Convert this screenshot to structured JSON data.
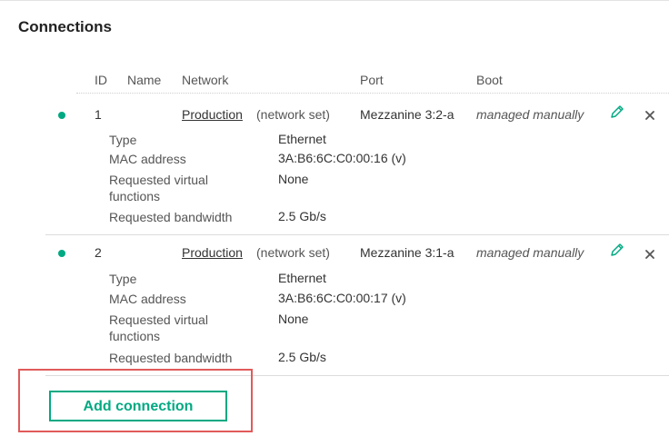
{
  "section": {
    "title": "Connections"
  },
  "table": {
    "headers": {
      "id": "ID",
      "name": "Name",
      "network": "Network",
      "port": "Port",
      "boot": "Boot"
    }
  },
  "connections": [
    {
      "id": "1",
      "network_name": "Production",
      "network_type": "(network set)",
      "port": "Mezzanine 3:2-a",
      "boot": "managed manually",
      "details": [
        {
          "label": "Type",
          "value": "Ethernet"
        },
        {
          "label": "MAC address",
          "value": "3A:B6:6C:C0:00:16 (v)"
        },
        {
          "label": "Requested virtual functions",
          "value": "None"
        },
        {
          "label": "Requested bandwidth",
          "value": "2.5 Gb/s"
        }
      ]
    },
    {
      "id": "2",
      "network_name": "Production",
      "network_type": "(network set)",
      "port": "Mezzanine 3:1-a",
      "boot": "managed manually",
      "details": [
        {
          "label": "Type",
          "value": "Ethernet"
        },
        {
          "label": "MAC address",
          "value": "3A:B6:6C:C0:00:17 (v)"
        },
        {
          "label": "Requested virtual functions",
          "value": "None"
        },
        {
          "label": "Requested bandwidth",
          "value": "2.5 Gb/s"
        }
      ]
    }
  ],
  "actions": {
    "add_connection": "Add connection"
  },
  "colors": {
    "accent": "#01a982",
    "highlight_box": "#e15a5a",
    "status_dot": "#01a982"
  }
}
